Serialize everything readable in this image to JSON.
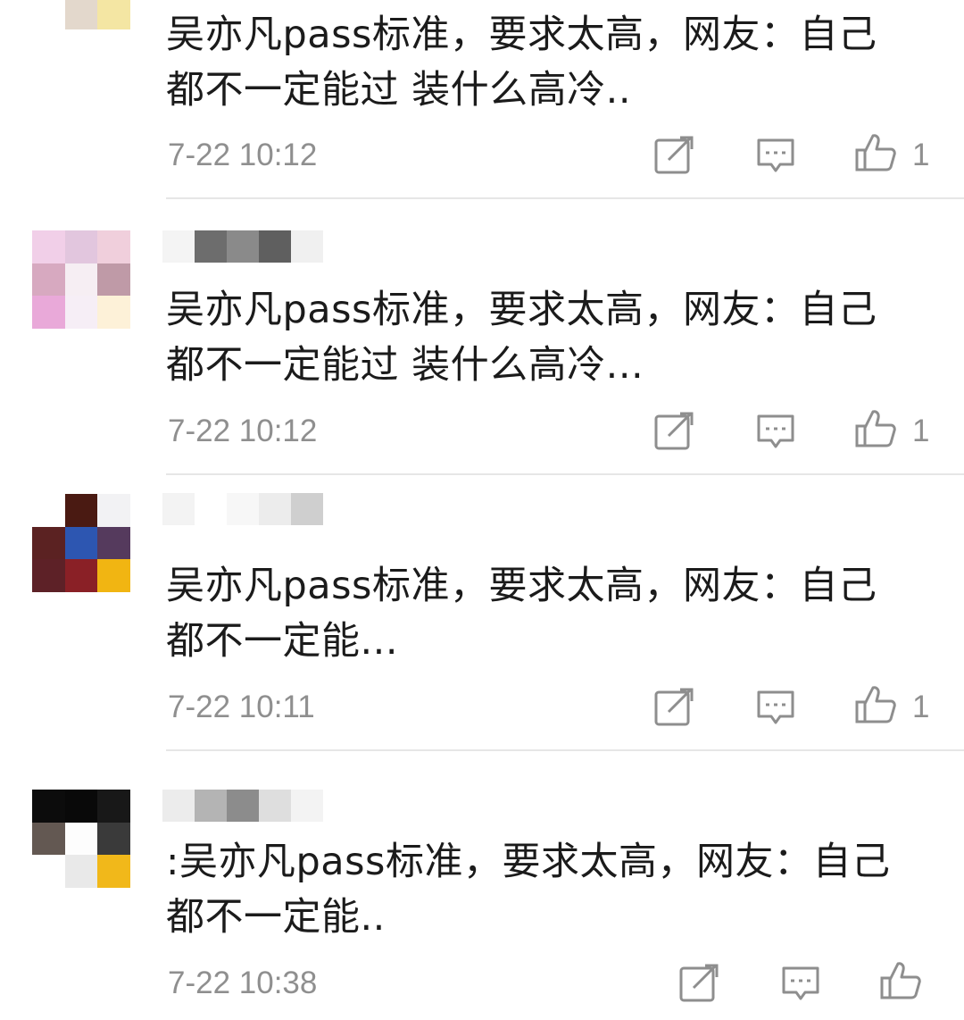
{
  "comments": [
    {
      "text": "吴亦凡pass标准，要求太高，网友：自己\n都不一定能过 装什么高冷..",
      "time": "7-22 10:12",
      "likes": "1",
      "avatar_colors": [
        "#c9dcc2",
        "#d9d0c5",
        "#eeeec9",
        "#ffffff",
        "#e3d8cc",
        "#f4e6a3",
        "#ffffff",
        "#ffffff",
        "#ffffff"
      ],
      "username_blocks": []
    },
    {
      "text": "吴亦凡pass标准，要求太高，网友：自己\n都不一定能过 装什么高冷...",
      "time": "7-22 10:12",
      "likes": "1",
      "avatar_colors": [
        "#f1cfe8",
        "#e2c6de",
        "#f0cfdc",
        "#d7a9c0",
        "#f6eef3",
        "#bf9aa7",
        "#e9a9d9",
        "#f6eef6",
        "#fdf1d8"
      ],
      "username_blocks": [
        "#f4f4f4",
        "#6d6d6d",
        "#8a8a8a",
        "#5f5f5f",
        "#f0f0f0"
      ]
    },
    {
      "text": "吴亦凡pass标准，要求太高，网友：自己\n都不一定能...",
      "time": "7-22 10:11",
      "likes": "1",
      "avatar_colors": [
        "#ffffff",
        "#4a1a12",
        "#f2f2f4",
        "#5b2222",
        "#2d56b1",
        "#553a5d",
        "#5d2127",
        "#8a2026",
        "#f1b512"
      ],
      "username_blocks": [
        "#f3f3f3",
        "#ffffff",
        "#f7f7f7",
        "#ececec",
        "#cfcfcf"
      ]
    },
    {
      "text": ":吴亦凡pass标准，要求太高，网友：自己\n都不一定能..",
      "time": "7-22 10:38",
      "likes": "",
      "avatar_colors": [
        "#0c0c0c",
        "#090909",
        "#181818",
        "#635852",
        "#fdfdfd",
        "#3a3a3a",
        "#ffffff",
        "#e9e9e9",
        "#f1b81a"
      ],
      "username_blocks": [
        "#ececec",
        "#b4b4b4",
        "#8c8c8c",
        "#dedede",
        "#f3f3f3"
      ]
    }
  ]
}
